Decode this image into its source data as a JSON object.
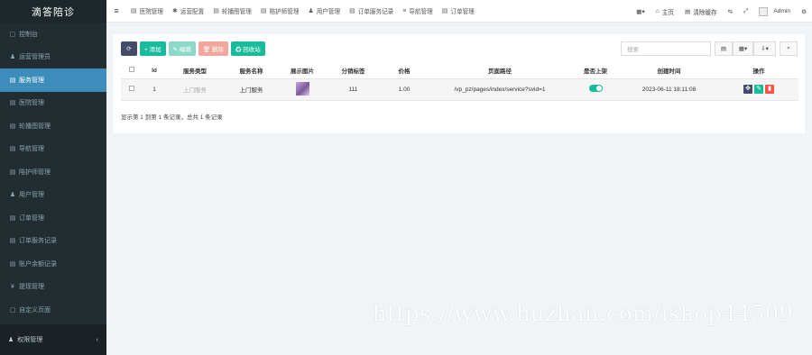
{
  "app": {
    "title": "滴答陪诊"
  },
  "sidebar": {
    "items": [
      {
        "icon": "▢",
        "label": "控制台"
      },
      {
        "icon": "♟",
        "label": "运营管理员"
      },
      {
        "icon": "▤",
        "label": "服务管理"
      },
      {
        "icon": "▤",
        "label": "医院管理"
      },
      {
        "icon": "▤",
        "label": "轮播图管理"
      },
      {
        "icon": "▤",
        "label": "导航管理"
      },
      {
        "icon": "▤",
        "label": "陪护师管理"
      },
      {
        "icon": "♟",
        "label": "用户管理"
      },
      {
        "icon": "▤",
        "label": "订单管理"
      },
      {
        "icon": "▤",
        "label": "订单服务记录"
      },
      {
        "icon": "▤",
        "label": "账户余额记录"
      },
      {
        "icon": "¥",
        "label": "提现管理"
      },
      {
        "icon": "▢",
        "label": "自定义页面"
      }
    ],
    "bottom": {
      "icon": "♟",
      "label": "权限管理",
      "arrow": "‹"
    }
  },
  "header": {
    "menu_icon": "≡",
    "nav": [
      {
        "icon": "▤",
        "label": "医院管理"
      },
      {
        "icon": "✱",
        "label": "运营配置"
      },
      {
        "icon": "▤",
        "label": "轮播图管理"
      },
      {
        "icon": "▤",
        "label": "陪护师管理"
      },
      {
        "icon": "♟",
        "label": "用户管理"
      },
      {
        "icon": "▤",
        "label": "订单服务记录"
      },
      {
        "icon": "≡",
        "label": "导航管理"
      },
      {
        "icon": "▤",
        "label": "订单管理"
      }
    ],
    "right": {
      "grid_icon": "▦▾",
      "home": {
        "icon": "⌂",
        "label": "主页"
      },
      "clear": {
        "icon": "▤",
        "label": "清除缓存"
      },
      "translate_icon": "⇆",
      "fullscreen_icon": "⤢",
      "user": "Admin",
      "settings_icon": "⚙"
    }
  },
  "toolbar": {
    "refresh_icon": "⟳",
    "add_label": "+ 添加",
    "edit_label": "✎ 编辑",
    "delete_label": "🗑 删除",
    "recycle_label": "♻ 回收站",
    "search_placeholder": "搜索",
    "view_icon": "▤",
    "columns_icon": "▦▾",
    "export_icon": "⇩▾",
    "search_icon": "⌕"
  },
  "table": {
    "headers": [
      "",
      "Id",
      "服务类型",
      "服务名称",
      "展示图片",
      "分销标签",
      "价格",
      "页面路径",
      "是否上架",
      "创建时间",
      "操作"
    ],
    "rows": [
      {
        "id": "1",
        "type": "上门服务",
        "name": "上门服务",
        "tag": "111",
        "price": "1.00",
        "path": "/vp_pz/pages/index/service?svid=1",
        "created": "2023-06-11 18:11:08"
      }
    ],
    "op_icons": {
      "drag": "✥",
      "edit": "✎",
      "delete": "▮"
    }
  },
  "pagination": {
    "text": "显示第 1 到第 1 条记录，总共 1 条记录"
  },
  "watermark": "https://www.huzhan.com/ishop44509",
  "colors": {
    "sidebar": "#222d32",
    "active": "#3c8dbc",
    "primary": "#18bc9c",
    "danger": "#f75444",
    "dark": "#444c69"
  }
}
